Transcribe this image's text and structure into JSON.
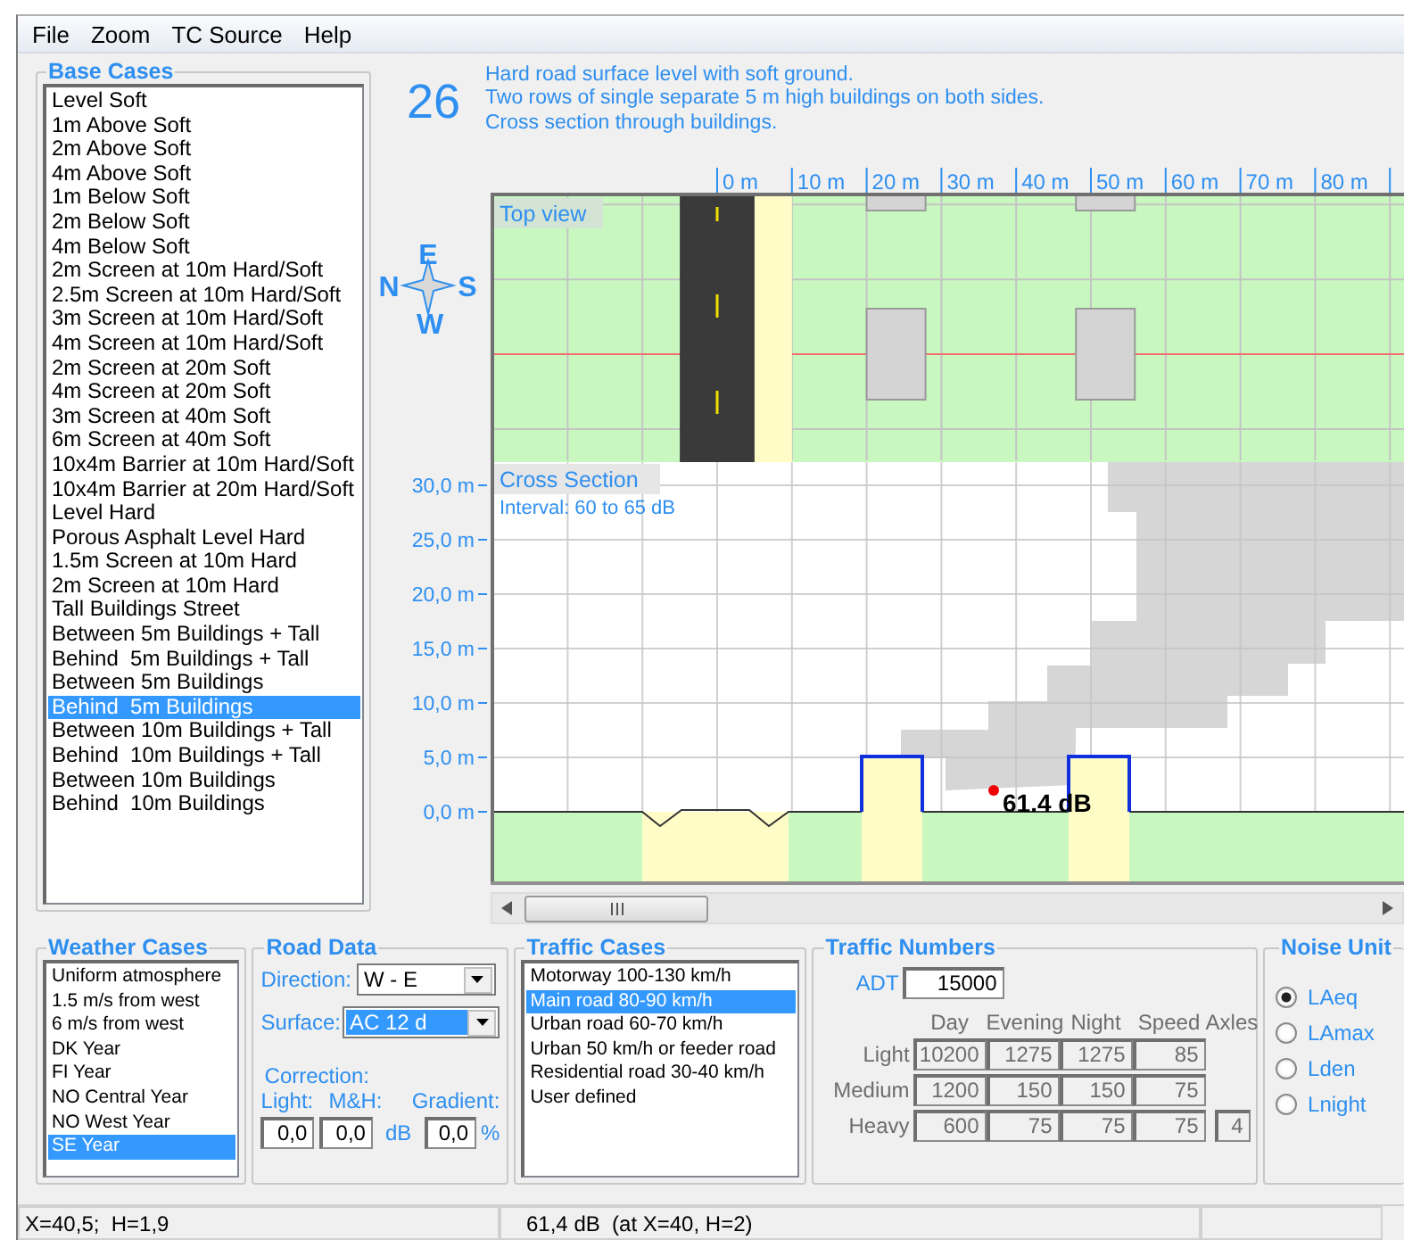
{
  "menu": [
    "File",
    "Zoom",
    "TC Source",
    "Help"
  ],
  "base_cases": {
    "title": "Base Cases",
    "items": [
      {
        "label": "Level Soft",
        "selected": false
      },
      {
        "label": "1m Above Soft",
        "selected": false
      },
      {
        "label": "2m Above Soft",
        "selected": false
      },
      {
        "label": "4m Above Soft",
        "selected": false
      },
      {
        "label": "1m Below Soft",
        "selected": false
      },
      {
        "label": "2m Below Soft",
        "selected": false
      },
      {
        "label": "4m Below Soft",
        "selected": false
      },
      {
        "label": "2m Screen at 10m Hard/Soft",
        "selected": false
      },
      {
        "label": "2.5m Screen at 10m Hard/Soft",
        "selected": false
      },
      {
        "label": "3m Screen at 10m Hard/Soft",
        "selected": false
      },
      {
        "label": "4m Screen at 10m Hard/Soft",
        "selected": false
      },
      {
        "label": "2m Screen at 20m Soft",
        "selected": false
      },
      {
        "label": "4m Screen at 20m Soft",
        "selected": false
      },
      {
        "label": "3m Screen at 40m Soft",
        "selected": false
      },
      {
        "label": "6m Screen at 40m Soft",
        "selected": false
      },
      {
        "label": "10x4m Barrier at 10m Hard/Soft",
        "selected": false
      },
      {
        "label": "10x4m Barrier at 20m Hard/Soft",
        "selected": false
      },
      {
        "label": "Level Hard",
        "selected": false
      },
      {
        "label": "Porous Asphalt Level Hard",
        "selected": false
      },
      {
        "label": "1.5m Screen at 10m Hard",
        "selected": false
      },
      {
        "label": "2m Screen at 10m Hard",
        "selected": false
      },
      {
        "label": "Tall Buildings Street",
        "selected": false
      },
      {
        "label": "Between 5m Buildings + Tall",
        "selected": false
      },
      {
        "label": "Behind  5m Buildings + Tall",
        "selected": false
      },
      {
        "label": "Between 5m Buildings",
        "selected": false
      },
      {
        "label": "Behind  5m Buildings",
        "selected": true
      },
      {
        "label": "Between 10m Buildings + Tall",
        "selected": false
      },
      {
        "label": "Behind  10m Buildings + Tall",
        "selected": false
      },
      {
        "label": "Between 10m Buildings",
        "selected": false
      },
      {
        "label": "Behind  10m Buildings",
        "selected": false
      }
    ]
  },
  "view": {
    "case_number": "26",
    "description": [
      "Hard road surface level with soft ground.",
      "Two rows of single separate 5 m high buildings on both sides.",
      "Cross section through buildings."
    ],
    "compass": {
      "north": "N",
      "east": "E",
      "south": "S",
      "west": "W"
    },
    "x_ticks": [
      "0 m",
      "10 m",
      "20 m",
      "30 m",
      "40 m",
      "50 m",
      "60 m",
      "70 m",
      "80 m"
    ],
    "top_view": {
      "title": "Top view"
    },
    "cross_section": {
      "title": "Cross Section",
      "interval": "Interval: 60 to 65 dB",
      "y_ticks": [
        "30,0 m",
        "25,0 m",
        "20,0 m",
        "15,0 m",
        "10,0 m",
        "5,0 m",
        "0,0 m"
      ],
      "receiver_label": "61.4 dB"
    }
  },
  "weather_cases": {
    "title": "Weather Cases",
    "items": [
      {
        "label": "Uniform atmosphere",
        "selected": false
      },
      {
        "label": "1.5 m/s from west",
        "selected": false
      },
      {
        "label": "6 m/s from west",
        "selected": false
      },
      {
        "label": "DK Year",
        "selected": false
      },
      {
        "label": "FI Year",
        "selected": false
      },
      {
        "label": "NO Central Year",
        "selected": false
      },
      {
        "label": "NO West Year",
        "selected": false
      },
      {
        "label": "SE Year",
        "selected": true
      }
    ]
  },
  "road_data": {
    "title": "Road Data",
    "direction": {
      "label": "Direction:",
      "value": "W - E",
      "focused": false
    },
    "surface": {
      "label": "Surface:",
      "value": "AC 12 d",
      "focused": true
    },
    "correction": {
      "label": "Correction:",
      "light_label": "Light:",
      "mh_label": "M&H:",
      "gradient_label": "Gradient:",
      "light": "0,0",
      "mh": "0,0",
      "db_unit": "dB",
      "gradient": "0,0",
      "percent_unit": "%"
    }
  },
  "traffic_cases": {
    "title": "Traffic Cases",
    "items": [
      {
        "label": "Motorway 100-130 km/h",
        "selected": false
      },
      {
        "label": "Main road 80-90 km/h",
        "selected": true
      },
      {
        "label": "Urban road 60-70 km/h",
        "selected": false
      },
      {
        "label": "Urban 50 km/h or feeder road",
        "selected": false
      },
      {
        "label": "Residential road 30-40 km/h",
        "selected": false
      },
      {
        "label": "User defined",
        "selected": false
      }
    ]
  },
  "traffic_numbers": {
    "title": "Traffic Numbers",
    "adt_label": "ADT",
    "adt": "15000",
    "disabled": true,
    "columns": [
      "Day",
      "Evening",
      "Night",
      "Speed",
      "Axles"
    ],
    "rows": [
      {
        "label": "Light",
        "values": [
          "10200",
          "1275",
          "1275",
          "85"
        ]
      },
      {
        "label": "Medium",
        "values": [
          "1200",
          "150",
          "150",
          "75"
        ]
      },
      {
        "label": "Heavy",
        "values": [
          "600",
          "75",
          "75",
          "75"
        ],
        "axles": "4"
      }
    ]
  },
  "noise_units": {
    "title": "Noise Unit",
    "items": [
      {
        "label": "LAeq",
        "selected": true
      },
      {
        "label": "LAmax",
        "selected": false
      },
      {
        "label": "Lden",
        "selected": false
      },
      {
        "label": "Lnight",
        "selected": false
      }
    ]
  },
  "status_bar": [
    "X=40,5;  H=1,9",
    "61,4 dB  (at X=40, H=2)"
  ]
}
